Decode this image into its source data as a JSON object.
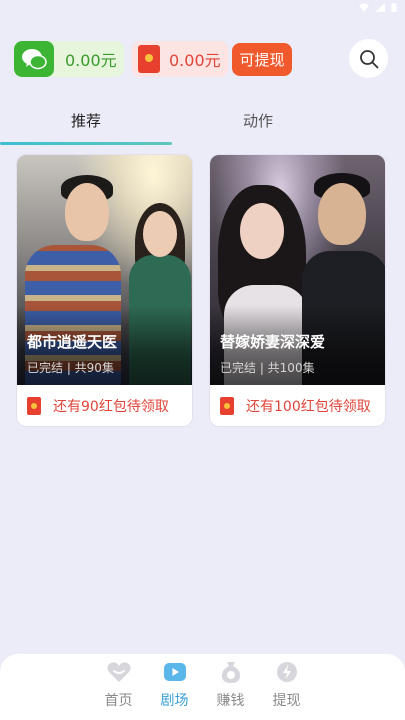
{
  "colors": {
    "background": "#ecebf8",
    "accent_green": "#3db534",
    "accent_red": "#e8402e",
    "withdraw_orange": "#f0592c",
    "nav_active": "#3a9fd6"
  },
  "status_bar": {
    "icons": [
      "wifi-icon",
      "signal-icon",
      "battery-icon"
    ]
  },
  "wallet": {
    "wechat_icon": "wechat-icon",
    "wechat_amount": "0.00元",
    "redpacket_icon": "red-envelope-icon",
    "redpacket_amount": "0.00元",
    "withdraw_label": "可提现"
  },
  "search": {
    "icon": "search-icon"
  },
  "tabs": [
    {
      "label": "推荐",
      "active": true
    },
    {
      "label": "动作",
      "active": false
    }
  ],
  "dramas": [
    {
      "title": "都市逍遥天医",
      "meta": "已完结 | 共90集",
      "reward_text": "还有90红包待领取"
    },
    {
      "title": "替嫁娇妻深深爱",
      "meta": "已完结 | 共100集",
      "reward_text": "还有100红包待领取"
    }
  ],
  "bottom_nav": [
    {
      "label": "首页",
      "icon": "home-heart-icon",
      "active": false
    },
    {
      "label": "剧场",
      "icon": "theater-play-icon",
      "active": true
    },
    {
      "label": "赚钱",
      "icon": "money-bag-icon",
      "active": false
    },
    {
      "label": "提现",
      "icon": "withdraw-coin-icon",
      "active": false
    }
  ]
}
